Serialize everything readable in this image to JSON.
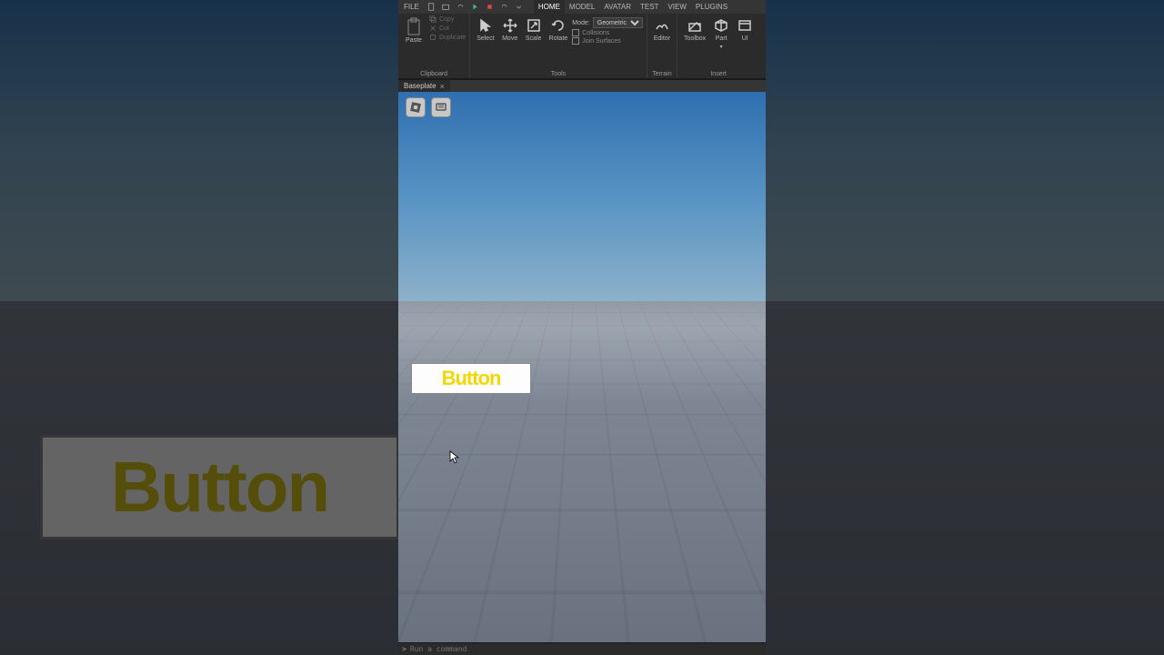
{
  "menu": {
    "file": "FILE",
    "tabs": [
      "HOME",
      "MODEL",
      "AVATAR",
      "TEST",
      "VIEW",
      "PLUGINS"
    ],
    "active": 0
  },
  "ribbon": {
    "clipboard": {
      "paste": "Paste",
      "copy": "Copy",
      "cut": "Cut",
      "duplicate": "Duplicate",
      "label": "Clipboard"
    },
    "tools": {
      "select": "Select",
      "move": "Move",
      "scale": "Scale",
      "rotate": "Rotate",
      "mode_label": "Mode:",
      "mode_value": "Geometric",
      "collisions": "Collisions",
      "join": "Join Surfaces",
      "label": "Tools"
    },
    "terrain": {
      "editor": "Editor",
      "label": "Terrain"
    },
    "insert": {
      "toolbox": "Toolbox",
      "part": "Part",
      "ui": "UI",
      "label": "Insert"
    }
  },
  "doctab": {
    "name": "Baseplate"
  },
  "viewport": {
    "button_text": "Button"
  },
  "cmd": {
    "placeholder": "Run a command",
    "prompt": ">"
  }
}
